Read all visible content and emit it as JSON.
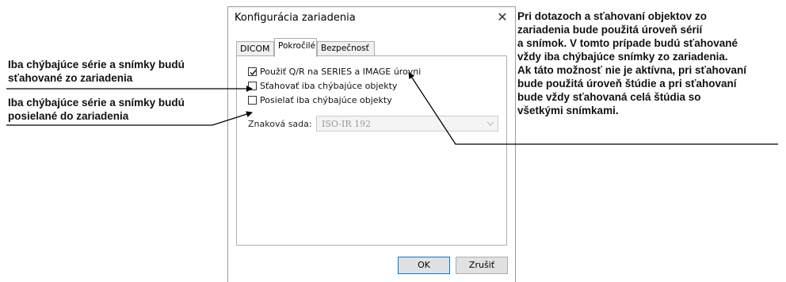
{
  "callouts": {
    "left_1": "Iba chýbajúce série a snímky budú\nsťahované zo zariadenia",
    "left_2": "Iba chýbajúce série a snímky budú\nposielané do zariadenia",
    "right": "Pri dotazoch a sťahovaní objektov zo\nzariadenia bude použitá úroveň sérií\na snímok. V tomto prípade budú sťahované\nvždy iba chýbajúce snímky zo zariadenia.\nAk táto možnosť nie je aktívna, pri sťahovaní\nbude použitá úroveň štúdie a pri sťahovaní\nbude vždy sťahovaná celá štúdia so\nvšetkými snímkami."
  },
  "dialog": {
    "title": "Konfigurácia zariadenia",
    "close_glyph": "✕",
    "tabs": [
      {
        "label": "DICOM",
        "active": false
      },
      {
        "label": "Pokročilé",
        "active": true
      },
      {
        "label": "Bezpečnosť",
        "active": false
      }
    ],
    "options": [
      {
        "label": "Použiť Q/R na SERIES a IMAGE úrovni",
        "checked": true
      },
      {
        "label": "Sťahovať iba chýbajúce objekty",
        "checked": false
      },
      {
        "label": "Posielať iba chýbajúce objekty",
        "checked": false
      }
    ],
    "charset": {
      "label": "Znaková sada:",
      "value": "ISO-IR 192",
      "disabled": true
    },
    "buttons": {
      "ok": "OK",
      "cancel": "Zrušiť"
    }
  },
  "colors": {
    "accent": "#0078d7",
    "border": "#adadad",
    "disabled_text": "#9a9a9a"
  }
}
